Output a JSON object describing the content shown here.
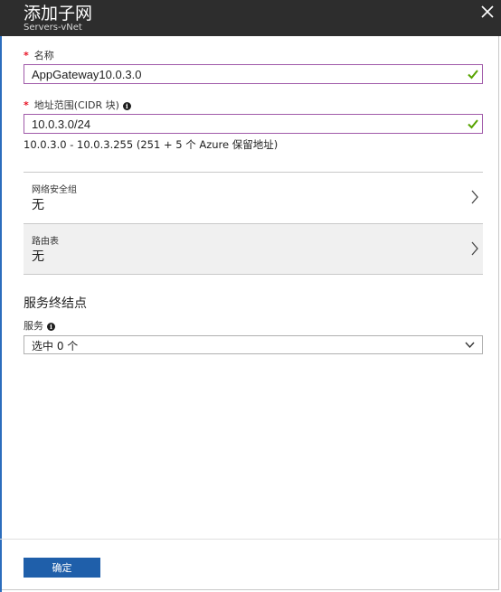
{
  "header": {
    "title": "添加子网",
    "subtitle": "Servers-vNet"
  },
  "form": {
    "name": {
      "required_mark": "*",
      "label": "名称",
      "value": "AppGateway10.0.3.0"
    },
    "address_range": {
      "required_mark": "*",
      "label": "地址范围(CIDR 块)",
      "value": "10.0.3.0/24",
      "hint": "10.0.3.0 - 10.0.3.255 (251 + 5 个 Azure 保留地址)"
    },
    "nsg": {
      "label": "网络安全组",
      "value": "无"
    },
    "route_table": {
      "label": "路由表",
      "value": "无"
    },
    "service_endpoints": {
      "section_title": "服务终结点",
      "services_label": "服务",
      "services_value": "选中 0 个"
    }
  },
  "footer": {
    "ok_label": "确定"
  },
  "colors": {
    "header_bg": "#2d2d2d",
    "valid_border": "#a05aa9",
    "check": "#57a300",
    "primary_button": "#1f5faa",
    "required": "#e81123"
  },
  "icons": {
    "close": "close-icon",
    "valid": "check-icon",
    "info": "info-icon",
    "nav": "chevron-right-icon",
    "dropdown": "chevron-down-icon"
  }
}
